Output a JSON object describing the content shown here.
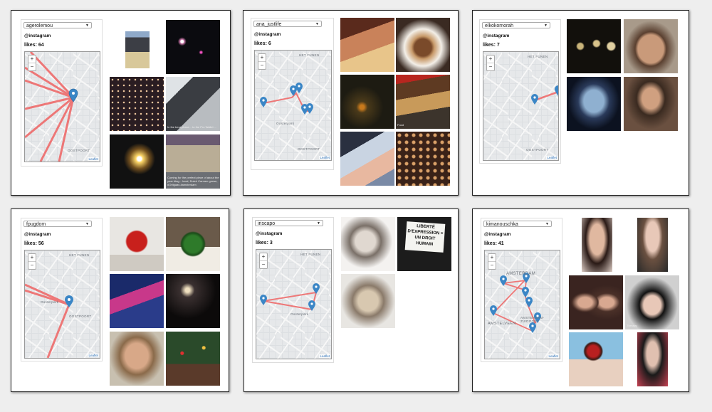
{
  "ui": {
    "instagram_label": "@instagram",
    "leaflet_label": "Leaflet"
  },
  "cards": [
    {
      "user": "agerolemou",
      "likes": "likes: 64",
      "map_labels": [
        "OOSTPOORT"
      ],
      "captions": [
        "",
        "",
        "",
        "In the best phase... to the Pro Wallet ...",
        "",
        "Coming for the perfect piece of about the year #tag... local, Dutch Carmen grown, #Ortigaas #amsterdam"
      ]
    },
    {
      "user": "ana_justlife",
      "likes": "likes: 6",
      "map_labels": [
        "HET FUNEN",
        "Oosterpark",
        "OOSTPOORT"
      ],
      "captions": [
        "",
        "",
        "",
        "Food",
        "",
        ""
      ]
    },
    {
      "user": "elkokomorah",
      "likes": "likes: 7",
      "map_labels": [
        "HET FUNEN",
        "OOSTPOORT"
      ],
      "captions": [
        "",
        "",
        "",
        ""
      ]
    },
    {
      "user": "fpugdom",
      "likes": "likes: 56",
      "map_labels": [
        "HET FUNEN",
        "Oosterpark",
        "OOSTPOORT"
      ],
      "captions": [
        "",
        "",
        "",
        "",
        "",
        ""
      ]
    },
    {
      "user": "iriscapo",
      "likes": "likes: 3",
      "map_labels": [
        "HET FUNEN",
        "Oosterpark"
      ],
      "captions": [
        "",
        "LIBERTÉ D'EXPRESSION = UN DROIT HUMAIN",
        ""
      ]
    },
    {
      "user": "kimanouschka",
      "likes": "likes: 41",
      "map_labels": [
        "AMSTERDAM",
        "AMSTELVEEN",
        "AMSTERDAM-ZUIDOOST"
      ],
      "captions": [
        "",
        "",
        "",
        "Therapy",
        "",
        ""
      ]
    }
  ]
}
